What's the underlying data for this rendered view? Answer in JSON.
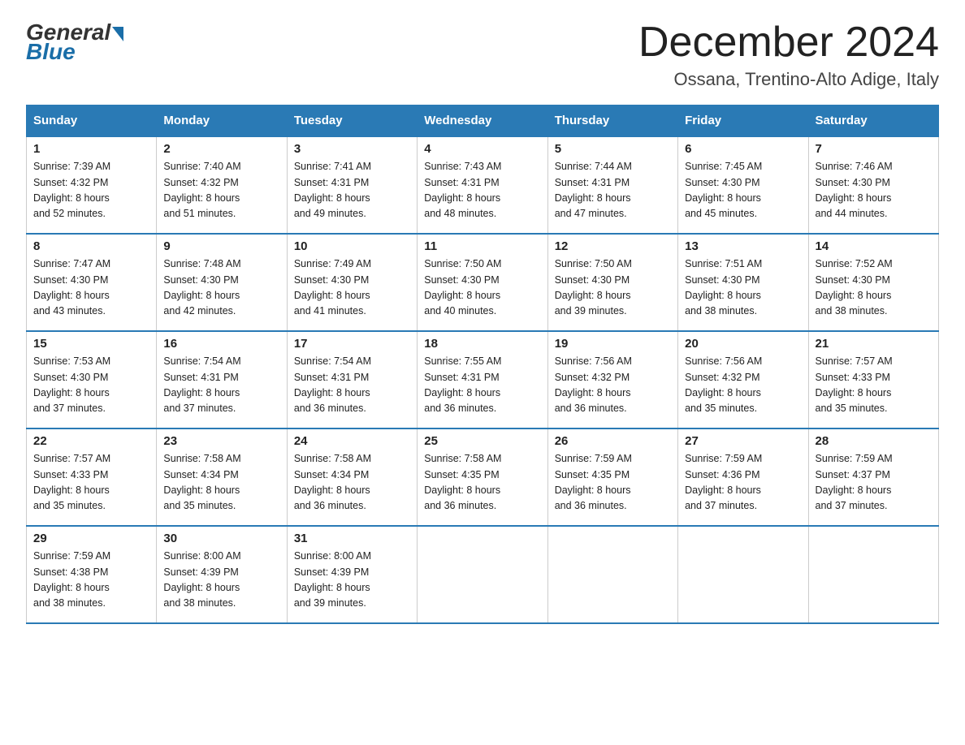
{
  "header": {
    "logo_general": "General",
    "logo_blue": "Blue",
    "month_title": "December 2024",
    "location": "Ossana, Trentino-Alto Adige, Italy"
  },
  "days_of_week": [
    "Sunday",
    "Monday",
    "Tuesday",
    "Wednesday",
    "Thursday",
    "Friday",
    "Saturday"
  ],
  "weeks": [
    [
      {
        "day": "1",
        "sunrise": "7:39 AM",
        "sunset": "4:32 PM",
        "daylight": "8 hours and 52 minutes."
      },
      {
        "day": "2",
        "sunrise": "7:40 AM",
        "sunset": "4:32 PM",
        "daylight": "8 hours and 51 minutes."
      },
      {
        "day": "3",
        "sunrise": "7:41 AM",
        "sunset": "4:31 PM",
        "daylight": "8 hours and 49 minutes."
      },
      {
        "day": "4",
        "sunrise": "7:43 AM",
        "sunset": "4:31 PM",
        "daylight": "8 hours and 48 minutes."
      },
      {
        "day": "5",
        "sunrise": "7:44 AM",
        "sunset": "4:31 PM",
        "daylight": "8 hours and 47 minutes."
      },
      {
        "day": "6",
        "sunrise": "7:45 AM",
        "sunset": "4:30 PM",
        "daylight": "8 hours and 45 minutes."
      },
      {
        "day": "7",
        "sunrise": "7:46 AM",
        "sunset": "4:30 PM",
        "daylight": "8 hours and 44 minutes."
      }
    ],
    [
      {
        "day": "8",
        "sunrise": "7:47 AM",
        "sunset": "4:30 PM",
        "daylight": "8 hours and 43 minutes."
      },
      {
        "day": "9",
        "sunrise": "7:48 AM",
        "sunset": "4:30 PM",
        "daylight": "8 hours and 42 minutes."
      },
      {
        "day": "10",
        "sunrise": "7:49 AM",
        "sunset": "4:30 PM",
        "daylight": "8 hours and 41 minutes."
      },
      {
        "day": "11",
        "sunrise": "7:50 AM",
        "sunset": "4:30 PM",
        "daylight": "8 hours and 40 minutes."
      },
      {
        "day": "12",
        "sunrise": "7:50 AM",
        "sunset": "4:30 PM",
        "daylight": "8 hours and 39 minutes."
      },
      {
        "day": "13",
        "sunrise": "7:51 AM",
        "sunset": "4:30 PM",
        "daylight": "8 hours and 38 minutes."
      },
      {
        "day": "14",
        "sunrise": "7:52 AM",
        "sunset": "4:30 PM",
        "daylight": "8 hours and 38 minutes."
      }
    ],
    [
      {
        "day": "15",
        "sunrise": "7:53 AM",
        "sunset": "4:30 PM",
        "daylight": "8 hours and 37 minutes."
      },
      {
        "day": "16",
        "sunrise": "7:54 AM",
        "sunset": "4:31 PM",
        "daylight": "8 hours and 37 minutes."
      },
      {
        "day": "17",
        "sunrise": "7:54 AM",
        "sunset": "4:31 PM",
        "daylight": "8 hours and 36 minutes."
      },
      {
        "day": "18",
        "sunrise": "7:55 AM",
        "sunset": "4:31 PM",
        "daylight": "8 hours and 36 minutes."
      },
      {
        "day": "19",
        "sunrise": "7:56 AM",
        "sunset": "4:32 PM",
        "daylight": "8 hours and 36 minutes."
      },
      {
        "day": "20",
        "sunrise": "7:56 AM",
        "sunset": "4:32 PM",
        "daylight": "8 hours and 35 minutes."
      },
      {
        "day": "21",
        "sunrise": "7:57 AM",
        "sunset": "4:33 PM",
        "daylight": "8 hours and 35 minutes."
      }
    ],
    [
      {
        "day": "22",
        "sunrise": "7:57 AM",
        "sunset": "4:33 PM",
        "daylight": "8 hours and 35 minutes."
      },
      {
        "day": "23",
        "sunrise": "7:58 AM",
        "sunset": "4:34 PM",
        "daylight": "8 hours and 35 minutes."
      },
      {
        "day": "24",
        "sunrise": "7:58 AM",
        "sunset": "4:34 PM",
        "daylight": "8 hours and 36 minutes."
      },
      {
        "day": "25",
        "sunrise": "7:58 AM",
        "sunset": "4:35 PM",
        "daylight": "8 hours and 36 minutes."
      },
      {
        "day": "26",
        "sunrise": "7:59 AM",
        "sunset": "4:35 PM",
        "daylight": "8 hours and 36 minutes."
      },
      {
        "day": "27",
        "sunrise": "7:59 AM",
        "sunset": "4:36 PM",
        "daylight": "8 hours and 37 minutes."
      },
      {
        "day": "28",
        "sunrise": "7:59 AM",
        "sunset": "4:37 PM",
        "daylight": "8 hours and 37 minutes."
      }
    ],
    [
      {
        "day": "29",
        "sunrise": "7:59 AM",
        "sunset": "4:38 PM",
        "daylight": "8 hours and 38 minutes."
      },
      {
        "day": "30",
        "sunrise": "8:00 AM",
        "sunset": "4:39 PM",
        "daylight": "8 hours and 38 minutes."
      },
      {
        "day": "31",
        "sunrise": "8:00 AM",
        "sunset": "4:39 PM",
        "daylight": "8 hours and 39 minutes."
      },
      null,
      null,
      null,
      null
    ]
  ],
  "labels": {
    "sunrise": "Sunrise:",
    "sunset": "Sunset:",
    "daylight": "Daylight:"
  }
}
